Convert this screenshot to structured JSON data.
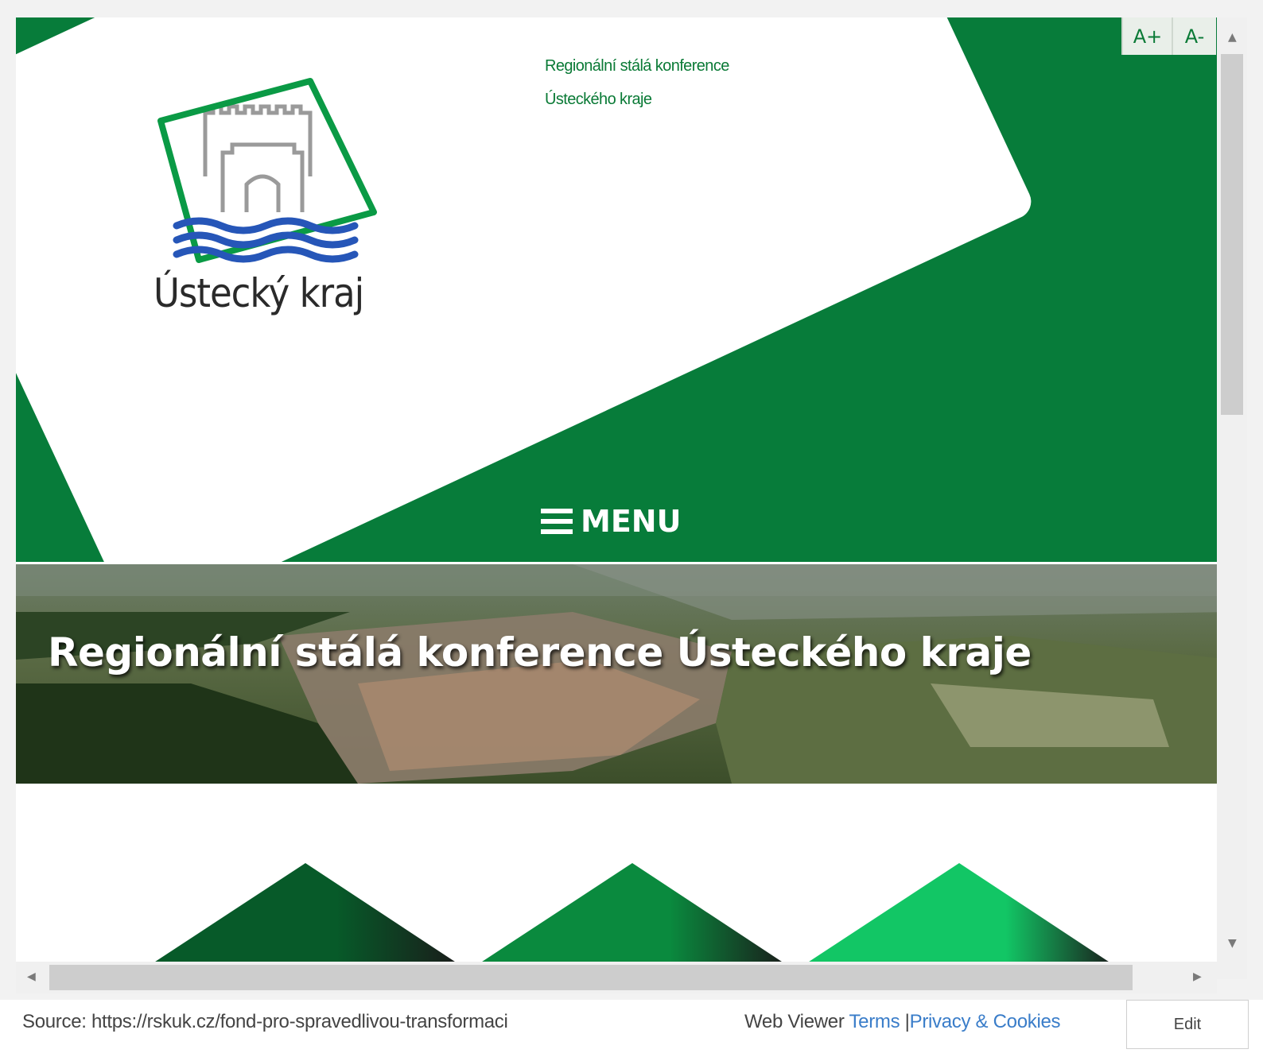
{
  "header": {
    "logo_text": "Ústecký kraj",
    "conference_line1": "Regionální stálá konference",
    "conference_line2": "Ústeckého kraje",
    "font_increase_label": "A+",
    "font_decrease_label": "A-",
    "menu_label": "MENU",
    "colors": {
      "primary_green": "#077c3a",
      "text_green": "#0a7a36",
      "water_blue": "#2656b8"
    }
  },
  "hero": {
    "title": "Regionální stálá konference Ústeckého kraje"
  },
  "tiles": {
    "colors": [
      "#075a29",
      "#0a8a3e",
      "#12c665"
    ]
  },
  "footer": {
    "source_text": "Source: https://rskuk.cz/fond-pro-spravedlivou-transformaci",
    "web_viewer_label": "Web Viewer",
    "terms_link": "Terms",
    "separator": "|",
    "privacy_link": "Privacy & Cookies",
    "edit_button": "Edit"
  }
}
